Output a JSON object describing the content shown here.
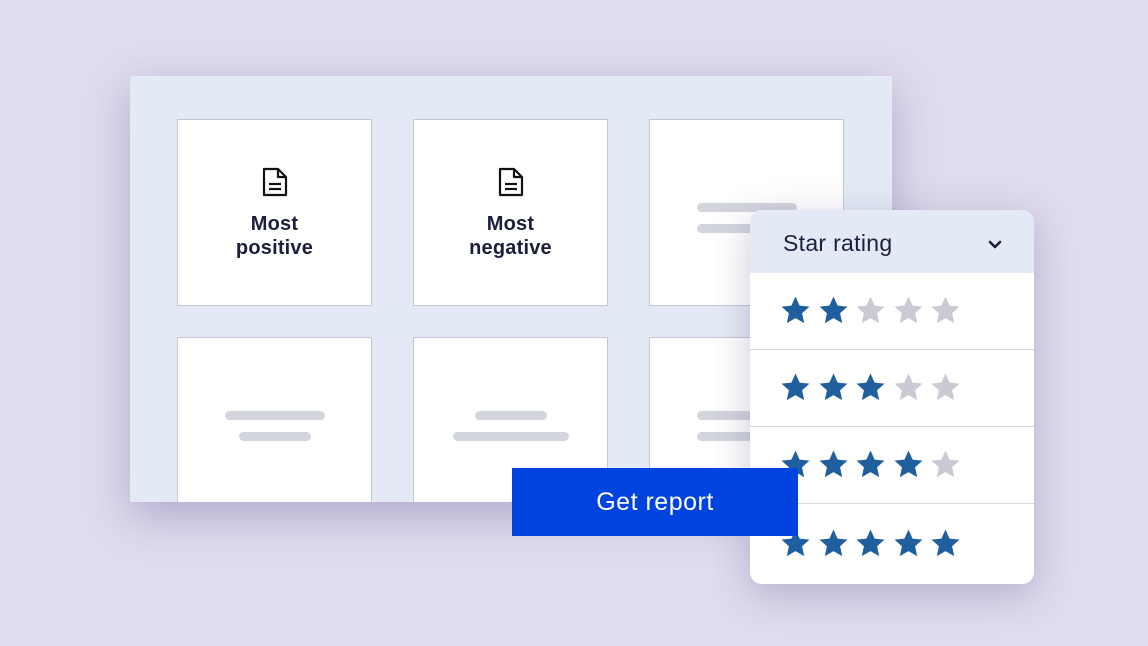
{
  "cards": [
    {
      "title": "Most positive",
      "icon": "document-icon"
    },
    {
      "title": "Most negative",
      "icon": "document-icon"
    }
  ],
  "dropdown": {
    "title": "Star rating",
    "icon": "chevron-down-icon",
    "options": [
      {
        "rating": 2,
        "max": 5
      },
      {
        "rating": 3,
        "max": 5
      },
      {
        "rating": 4,
        "max": 5
      },
      {
        "rating": 5,
        "max": 5
      }
    ]
  },
  "action": {
    "label": "Get report"
  },
  "colors": {
    "background": "#e0dbee",
    "panel": "#e4eaf5",
    "star_filled": "#1f5f9e",
    "star_empty": "#c9cad3",
    "button": "#0044e0",
    "text": "#1b1f3b",
    "placeholder_bar": "#d3d5dd"
  }
}
